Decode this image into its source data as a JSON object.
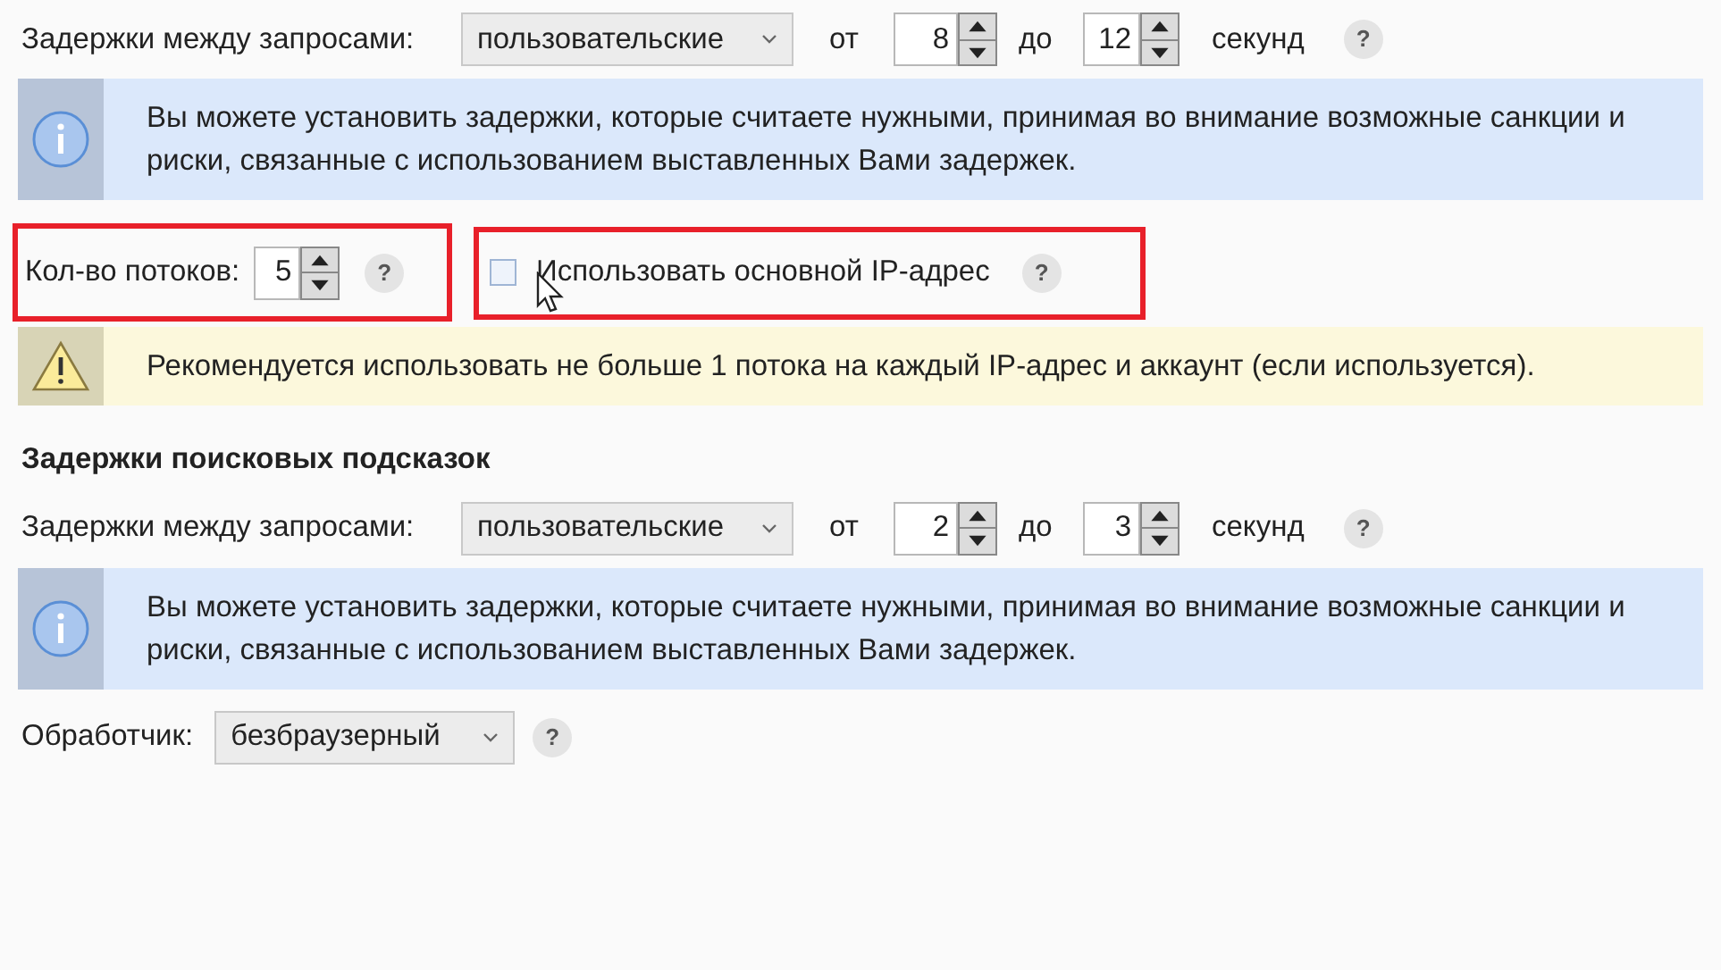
{
  "request_delays": {
    "label": "Задержки между запросами:",
    "mode": "пользовательские",
    "from_label": "от",
    "from": "8",
    "to_label": "до",
    "to": "12",
    "unit": "секунд",
    "help": "?"
  },
  "request_notice": {
    "kind": "info",
    "text": "Вы можете установить задержки, которые считаете нужными, принимая во внимание возможные санкции и риски, связанные с использованием выставленных Вами задержек."
  },
  "threads": {
    "label": "Кол-во потоков:",
    "value": "5",
    "help": "?",
    "highlighted": true
  },
  "main_ip": {
    "label": "Использовать основной IP-адрес",
    "checked": false,
    "help": "?",
    "highlighted": true
  },
  "threads_notice": {
    "kind": "warning",
    "text": "Рекомендуется использовать не больше 1 потока на каждый IP-адрес и аккаунт (если используется)."
  },
  "suggest_section": {
    "title": "Задержки поисковых подсказок",
    "delays": {
      "label": "Задержки между запросами:",
      "mode": "пользовательские",
      "from_label": "от",
      "from": "2",
      "to_label": "до",
      "to": "3",
      "unit": "секунд",
      "help": "?"
    },
    "notice": {
      "kind": "info",
      "text": "Вы можете установить задержки, которые считаете нужными, принимая во внимание возможные санкции и риски, связанные с использованием выставленных Вами задержек."
    }
  },
  "handler": {
    "label": "Обработчик:",
    "value": "безбраузерный",
    "help": "?"
  }
}
